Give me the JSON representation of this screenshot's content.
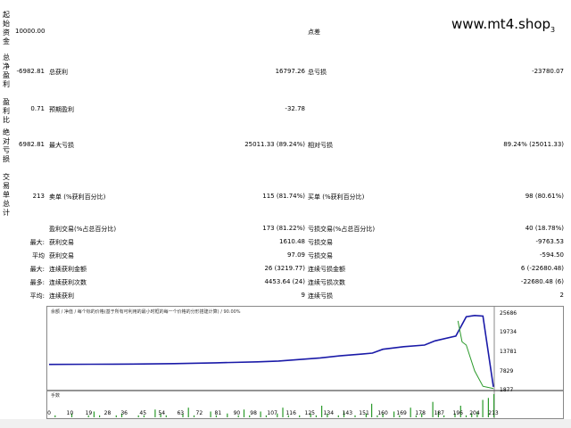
{
  "watermark": {
    "text": "www.mt4.shop",
    "sub": "3"
  },
  "vertical_labels": {
    "initial_deposit": "起始资金",
    "total_net_profit": "总净盈利",
    "profit_factor": "盈利比",
    "absolute_drawdown": "绝对亏损",
    "total_trades": "交易单总计"
  },
  "report": {
    "initial_deposit": "10000.00",
    "spread_label": "点差",
    "net_profit": "-6982.81",
    "gross_profit_label": "总获利",
    "gross_profit": "16797.26",
    "gross_loss_label": "总亏损",
    "gross_loss": "-23780.07",
    "profit_factor": "0.71",
    "expected_payoff_label": "预期盈利",
    "expected_payoff": "-32.78",
    "absolute_drawdown": "6982.81",
    "max_drawdown_label": "最大亏损",
    "max_drawdown": "25011.33 (89.24%)",
    "relative_drawdown_label": "相对亏损",
    "relative_drawdown": "89.24% (25011.33)",
    "total_trades": "213",
    "short_positions_label": "卖单 (%获利百分比)",
    "short_positions": "115 (81.74%)",
    "long_positions_label": "买单 (%获利百分比)",
    "long_positions": "98 (80.61%)",
    "profit_trades_label": "盈利交易(%占总百分比)",
    "profit_trades": "173 (81.22%)",
    "loss_trades_label": "亏损交易(%占总百分比)",
    "loss_trades": "40 (18.78%)",
    "largest_prefix": "最大:",
    "largest_profit_label": "获利交易",
    "largest_profit": "1610.48",
    "largest_loss_label": "亏损交易",
    "largest_loss": "-9763.53",
    "average_prefix": "平均",
    "average_profit_label": "获利交易",
    "average_profit": "97.09",
    "average_loss_label": "亏损交易",
    "average_loss": "-594.50",
    "max_prefix": "最大:",
    "max_consec_wins_label": "连续获利金额",
    "max_consec_wins": "26 (3219.77)",
    "max_consec_losses_label": "连续亏损金额",
    "max_consec_losses": "6 (-22680.48)",
    "maximal_prefix": "最多:",
    "maximal_consec_profit_label": "连续获利次数",
    "maximal_consec_profit": "4453.64 (24)",
    "maximal_consec_loss_label": "连续亏损次数",
    "maximal_consec_loss": "-22680.48 (6)",
    "avg_prefix": "平均:",
    "avg_consec_wins_label": "连续获利",
    "avg_consec_wins": "9",
    "avg_consec_losses_label": "连续亏损",
    "avg_consec_losses": "2"
  },
  "chart_data": {
    "type": "line",
    "legend_text": "余额 / 净值 / 每个标的价格(基于所有可利用的最小时框的每一个价格的分形搭建计算) / 90.00%",
    "volume_label": "手数",
    "x_ticks": [
      "0",
      "10",
      "19",
      "28",
      "36",
      "45",
      "54",
      "63",
      "72",
      "81",
      "90",
      "98",
      "107",
      "116",
      "125",
      "134",
      "143",
      "151",
      "160",
      "169",
      "178",
      "187",
      "196",
      "204",
      "213"
    ],
    "ylim": [
      1877,
      25686
    ],
    "y_ticks": [
      "25686",
      "19734",
      "13781",
      "7829",
      "1877"
    ],
    "series": [
      {
        "name": "余额",
        "color": "#1a1aa8",
        "points": [
          [
            0,
            10000
          ],
          [
            20,
            10050
          ],
          [
            40,
            10100
          ],
          [
            60,
            10250
          ],
          [
            80,
            10500
          ],
          [
            100,
            10800
          ],
          [
            110,
            11050
          ],
          [
            120,
            11500
          ],
          [
            130,
            12000
          ],
          [
            140,
            12700
          ],
          [
            150,
            13200
          ],
          [
            155,
            13500
          ],
          [
            160,
            14700
          ],
          [
            170,
            15500
          ],
          [
            180,
            16000
          ],
          [
            185,
            17300
          ],
          [
            195,
            18800
          ],
          [
            200,
            24800
          ],
          [
            204,
            25200
          ],
          [
            208,
            25000
          ],
          [
            213,
            3017
          ]
        ]
      },
      {
        "name": "净值",
        "color": "#2a9a2a",
        "points": [
          [
            196,
            23500
          ],
          [
            198,
            17000
          ],
          [
            200,
            16000
          ],
          [
            204,
            8000
          ],
          [
            208,
            3200
          ],
          [
            213,
            2500
          ]
        ]
      }
    ],
    "volumes": [
      0,
      1,
      0,
      0,
      2,
      0,
      0,
      1,
      3,
      1,
      0,
      0,
      1,
      2,
      0,
      0,
      1,
      1,
      0,
      4,
      2,
      1,
      0,
      0,
      2,
      5,
      1,
      0,
      0,
      3,
      1,
      0,
      2,
      0,
      1,
      4,
      1,
      0,
      3,
      1,
      0,
      2,
      5,
      1,
      0,
      1,
      0,
      2,
      1,
      6,
      2,
      0,
      1,
      3,
      0,
      1,
      0,
      2,
      7,
      1,
      2,
      0,
      3,
      1,
      0,
      5,
      1,
      2,
      0,
      8,
      3,
      1,
      0,
      2,
      6,
      1,
      2,
      3,
      9,
      10,
      12
    ]
  }
}
